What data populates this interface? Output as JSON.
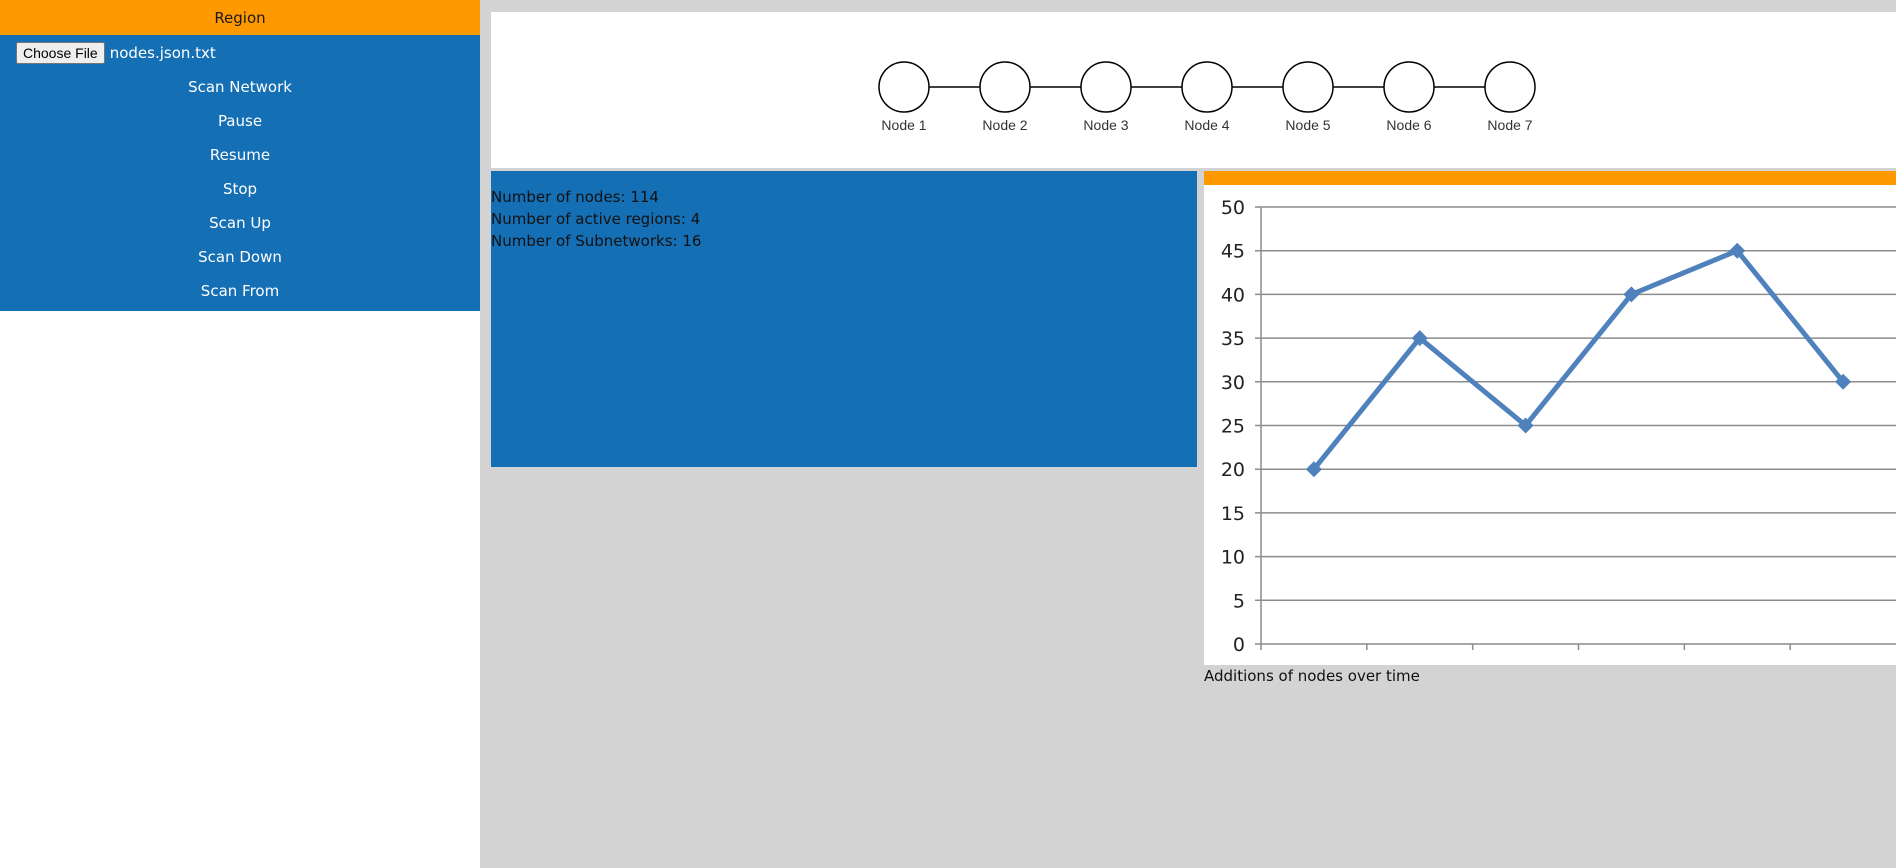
{
  "sidebar": {
    "header": "Region",
    "file_button": "Choose File",
    "file_name": "nodes.json.txt",
    "items": [
      {
        "label": "Scan Network"
      },
      {
        "label": "Pause"
      },
      {
        "label": "Resume"
      },
      {
        "label": "Stop"
      },
      {
        "label": "Scan Up"
      },
      {
        "label": "Scan Down"
      },
      {
        "label": "Scan From"
      }
    ]
  },
  "diagram": {
    "nodes": [
      "Node 1",
      "Node 2",
      "Node 3",
      "Node 4",
      "Node 5",
      "Node 6",
      "Node 7"
    ]
  },
  "stats": {
    "nodes": "Number of nodes: 114",
    "regions": "Number of active regions: 4",
    "subnetworks": "Number of Subnetworks: 16"
  },
  "chart_caption": "Additions of nodes over time",
  "colors": {
    "accent": "#ff9900",
    "panel_blue": "#156fb5",
    "series": "#4f81bd"
  },
  "chart_data": {
    "type": "line",
    "x": [
      1,
      2,
      3,
      4,
      5,
      6
    ],
    "series": [
      {
        "values": [
          20,
          35,
          25,
          40,
          45,
          30
        ]
      }
    ],
    "ylim": [
      0,
      50
    ],
    "yticks": [
      0,
      5,
      10,
      15,
      20,
      25,
      30,
      35,
      40,
      45,
      50
    ],
    "grid": true
  }
}
